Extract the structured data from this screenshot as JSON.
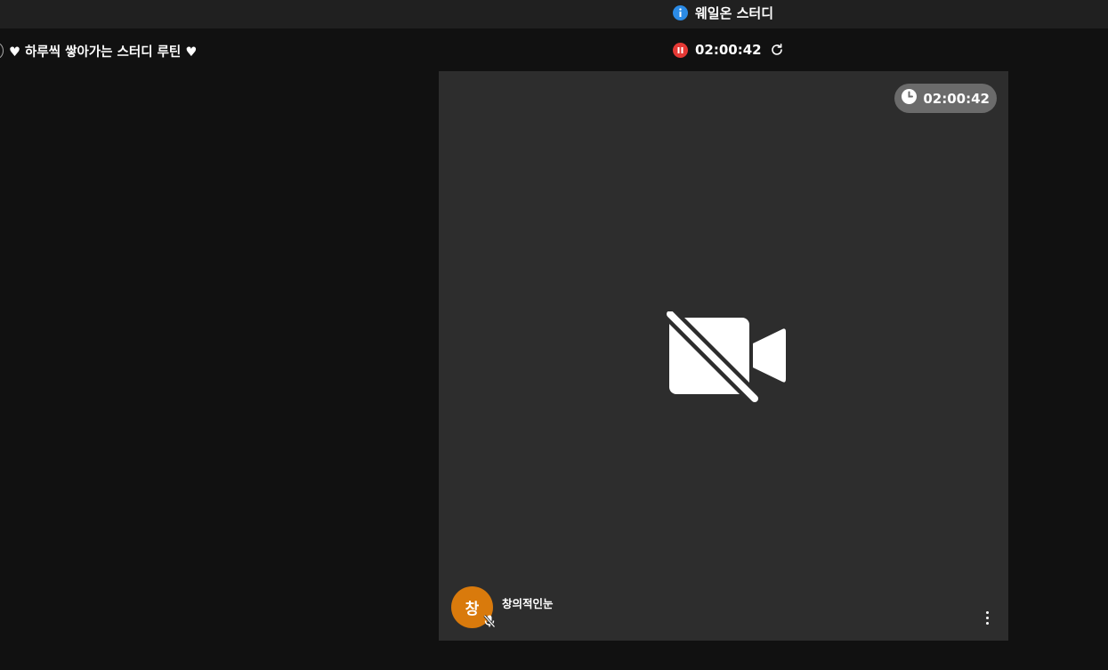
{
  "header": {
    "room_name": "웨일온 스터디",
    "info_icon": "info-icon"
  },
  "notice": {
    "text": "♥ 하루씩 쌓아가는 스터디 루틴 ♥"
  },
  "session": {
    "elapsed": "02:00:42",
    "status_icon": "pause-icon",
    "refresh_icon": "refresh-icon"
  },
  "tile": {
    "timer": "02:00:42",
    "camera_state_icon": "camera-off-icon",
    "user": {
      "avatar_initial": "창",
      "name": "창의적인눈",
      "avatar_color": "#d97a0c",
      "mic_icon": "mic-off-icon"
    },
    "menu_icon": "more-vertical-icon"
  },
  "colors": {
    "background": "#111111",
    "topbar": "#202020",
    "tile": "#2d2d2d",
    "info": "#2b8be6",
    "recording": "#e53935"
  }
}
